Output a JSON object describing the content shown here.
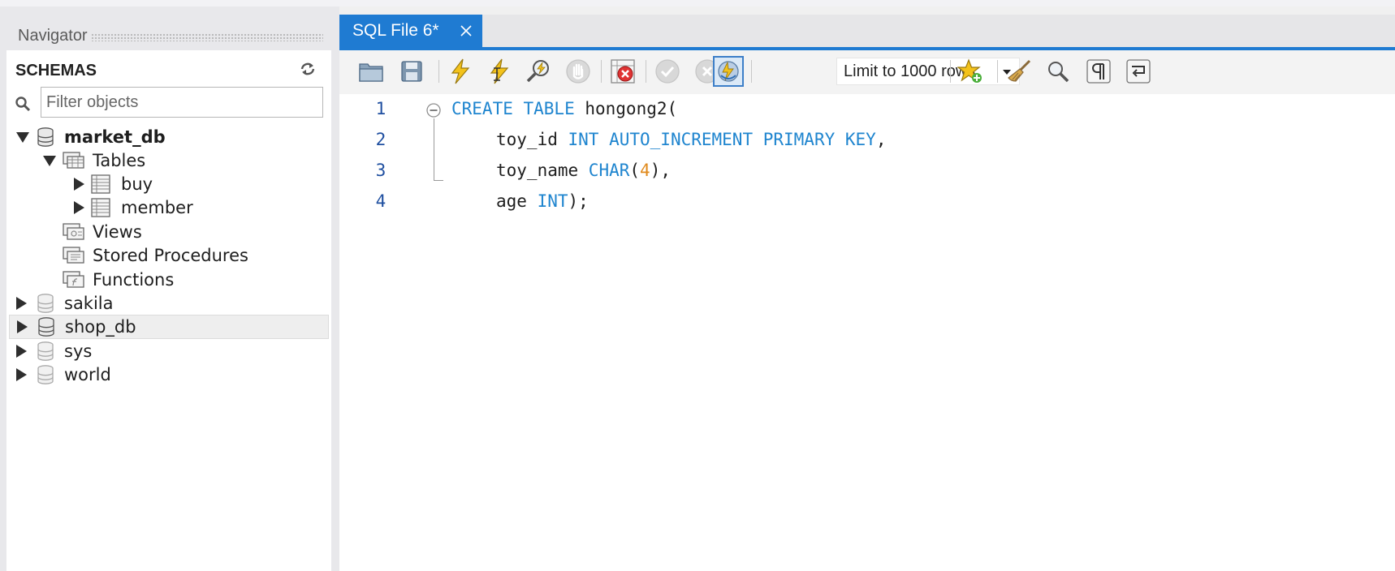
{
  "navigator": {
    "title": "Navigator",
    "schemas_label": "SCHEMAS",
    "filter_placeholder": "Filter objects",
    "tree": {
      "market_db": "market_db",
      "tables": "Tables",
      "buy": "buy",
      "member": "member",
      "views": "Views",
      "stored_procedures": "Stored Procedures",
      "functions": "Functions",
      "sakila": "sakila",
      "shop_db": "shop_db",
      "sys": "sys",
      "world": "world"
    }
  },
  "editor": {
    "tab_label": "SQL File 6*",
    "limit_label": "Limit to 1000 rows",
    "lines": {
      "n1": "1",
      "n2": "2",
      "n3": "3",
      "n4": "4",
      "l1_kw": "CREATE TABLE",
      "l1_txt": " hongong2(",
      "l2_txt": "toy_id ",
      "l2_kw": "INT AUTO_INCREMENT PRIMARY KEY",
      "l2_end": ",",
      "l3_txt": "toy_name ",
      "l3_kw": "CHAR",
      "l3_p1": "(",
      "l3_num": "4",
      "l3_end": "),",
      "l4_txt": "age ",
      "l4_kw": "INT",
      "l4_end": ");"
    }
  },
  "colors": {
    "accent": "#1f7bd2",
    "keyword": "#1f85cf",
    "number": "#e08a1d"
  }
}
